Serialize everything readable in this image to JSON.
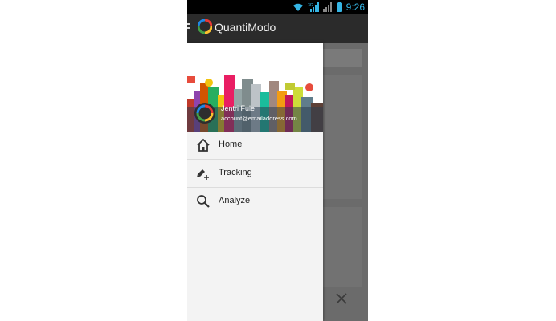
{
  "status_bar": {
    "time": "9:26",
    "signal_label": "3G",
    "icons": [
      "wifi-icon",
      "signal-icon",
      "battery-icon"
    ]
  },
  "action_bar": {
    "title": "QuantiModo",
    "icons": [
      "menu-icon",
      "app-logo-icon"
    ]
  },
  "drawer": {
    "user": {
      "name": "Jentri Fule",
      "email": "account@emailaddress.com"
    },
    "items": [
      {
        "label": "Home",
        "icon": "home-icon"
      },
      {
        "label": "Tracking",
        "icon": "tracking-icon"
      },
      {
        "label": "Analyze",
        "icon": "search-icon"
      }
    ]
  },
  "colors": {
    "status_time": "#35b5e5",
    "action_bar": "#2b2b2b",
    "drawer_bg": "#f3f3f3",
    "scrim": "#6b6b6b"
  }
}
